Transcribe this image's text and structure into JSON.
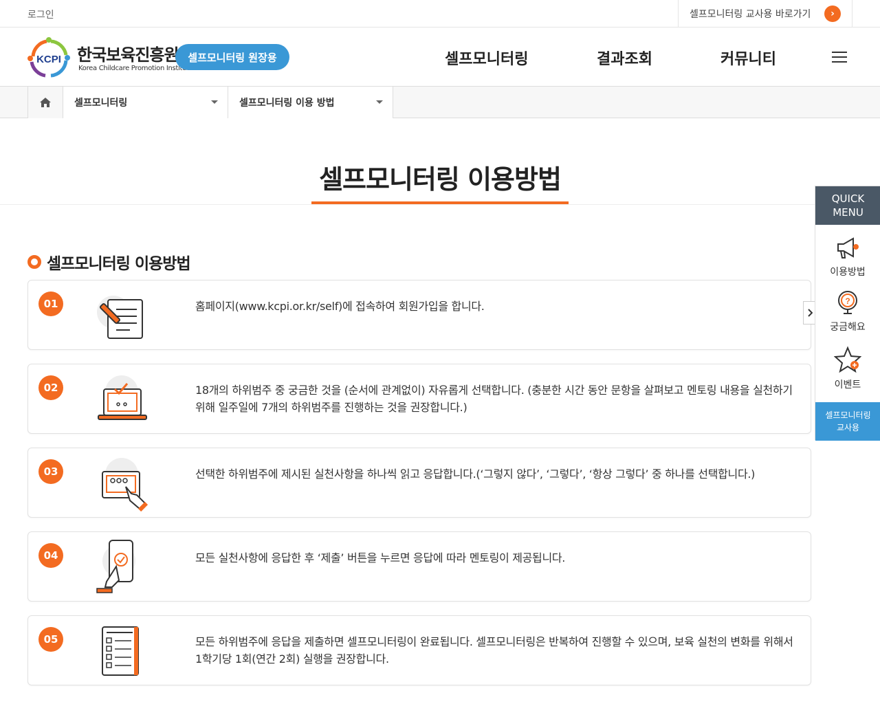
{
  "topbar": {
    "login_label": "로그인",
    "teacher_link_label": "셀프모니터링 교사용 바로가기",
    "teacher_link_icon": "chevron-right-icon"
  },
  "header": {
    "logo_text": "한국보육진흥원",
    "logo_mark_text": "KCPI",
    "logo_subtitle": "Korea Childcare Promotion Institute",
    "role_badge": "셀프모니터링 원장용",
    "nav": [
      "셀프모니터링",
      "결과조회",
      "커뮤니티"
    ],
    "menu_icon": "hamburger-icon"
  },
  "breadcrumb": {
    "home_icon": "home-icon",
    "level1": "셀프모니터링",
    "level2": "셀프모니터링 이용 방법"
  },
  "page": {
    "title": "셀프모니터링 이용방법",
    "section_title": "셀프모니터링 이용방법"
  },
  "steps": [
    {
      "num": "01",
      "icon": "document-pen-icon",
      "text": "홈페이지(www.kcpi.or.kr/self)에 접속하여 회원가입을 합니다."
    },
    {
      "num": "02",
      "icon": "laptop-check-icon",
      "text": "18개의 하위범주 중 궁금한 것을 (순서에 관계없이) 자유롭게 선택합니다. (충분한 시간 동안 문항을 살펴보고 멘토링 내용을 실천하기 위해 일주일에 7개의 하위범주를 진행하는 것을 권장합니다.)"
    },
    {
      "num": "03",
      "icon": "monitor-click-icon",
      "text": "선택한 하위범주에 제시된 실천사항을 하나씩 읽고 응답합니다.(‘그렇지 않다’, ‘그렇다’, ‘항상 그렇다’ 중 하나를 선택합니다.)"
    },
    {
      "num": "04",
      "icon": "phone-tap-icon",
      "text": "모든 실천사항에 응답한 후 ‘제출’ 버튼을 누르면 응답에 따라 멘토링이 제공됩니다."
    },
    {
      "num": "05",
      "icon": "checklist-icon",
      "text": "모든 하위범주에 응답을 제출하면 셀프모니터링이 완료됩니다. 셀프모니터링은 반복하여 진행할 수 있으며, 보육 실천의 변화를 위해서 1학기당 1회(연간 2회) 실행을 권장합니다."
    }
  ],
  "quick_menu": {
    "title_line1": "QUICK",
    "title_line2": "MENU",
    "items": [
      {
        "label": "이용방법",
        "icon": "megaphone-icon"
      },
      {
        "label": "궁금해요",
        "icon": "question-icon"
      },
      {
        "label": "이벤트",
        "icon": "star-icon"
      }
    ],
    "teacher_line1": "셀프모니터링",
    "teacher_line2": "교사용",
    "toggle_icon": "chevron-right-icon"
  },
  "colors": {
    "accent": "#f36b21",
    "blue": "#3a98d6",
    "quick_head": "#4a5866"
  }
}
